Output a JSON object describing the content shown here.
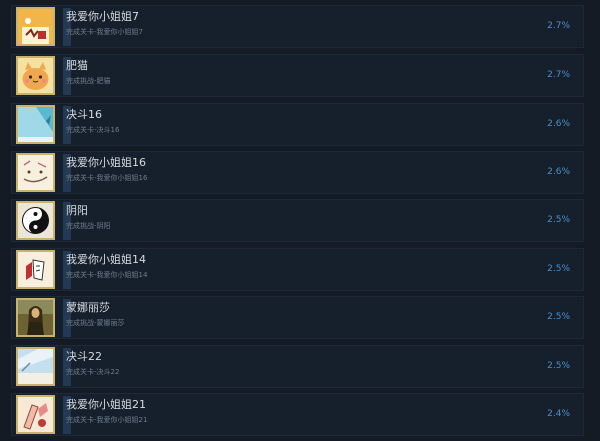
{
  "achievements": [
    {
      "title": "我爱你小姐姐7",
      "description": "完成关卡-我爱你小姐姐7",
      "percent": "2.7%",
      "icon": "girl-drawing-7-icon",
      "icon_bg": "#f2b54a"
    },
    {
      "title": "肥猫",
      "description": "完成挑战-肥猫",
      "percent": "2.7%",
      "icon": "fat-cat-icon",
      "icon_bg": "#f1d87a"
    },
    {
      "title": "决斗16",
      "description": "完成关卡-决斗16",
      "percent": "2.6%",
      "icon": "duel-16-icon",
      "icon_bg": "#8fd0e0"
    },
    {
      "title": "我爱你小姐姐16",
      "description": "完成关卡-我爱你小姐姐16",
      "percent": "2.6%",
      "icon": "girl-drawing-16-icon",
      "icon_bg": "#f3eccf"
    },
    {
      "title": "阴阳",
      "description": "完成挑战-阴阳",
      "percent": "2.5%",
      "icon": "yin-yang-icon",
      "icon_bg": "#e8e4d6"
    },
    {
      "title": "我爱你小姐姐14",
      "description": "完成关卡-我爱你小姐姐14",
      "percent": "2.5%",
      "icon": "girl-drawing-14-icon",
      "icon_bg": "#f5ecd6"
    },
    {
      "title": "蒙娜丽莎",
      "description": "完成挑战-蒙娜丽莎",
      "percent": "2.5%",
      "icon": "mona-lisa-icon",
      "icon_bg": "#7a6a3a"
    },
    {
      "title": "决斗22",
      "description": "完成关卡-决斗22",
      "percent": "2.5%",
      "icon": "duel-22-icon",
      "icon_bg": "#b9d8e8"
    },
    {
      "title": "我爱你小姐姐21",
      "description": "完成关卡-我爱你小姐姐21",
      "percent": "2.4%",
      "icon": "girl-drawing-21-icon",
      "icon_bg": "#f4e7d2"
    }
  ],
  "colors": {
    "background": "#141b24",
    "row": "#16202d",
    "title": "#d6dbe0",
    "description": "#6f7c8a",
    "percent": "#4f8fc5",
    "icon_border": "#c9b36b"
  }
}
